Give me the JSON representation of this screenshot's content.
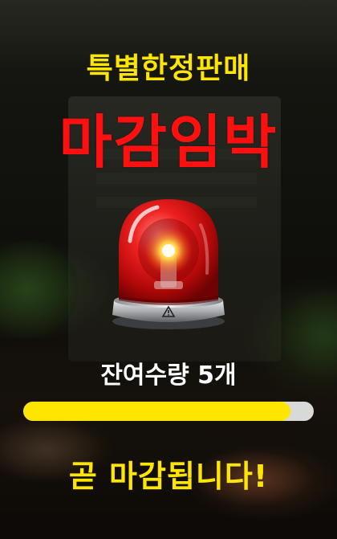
{
  "headline": "특별한정판매",
  "title": "마감임박",
  "siren_icon": "red-siren-icon",
  "remaining_text": "잔여수량 5개",
  "progress_fraction": 0.92,
  "closing_text": "곧 마감됩니다!",
  "colors": {
    "headline": "#ffe600",
    "title": "#ff1010",
    "progress_fill": "#ffe500",
    "progress_track": "#d9d9d9"
  }
}
